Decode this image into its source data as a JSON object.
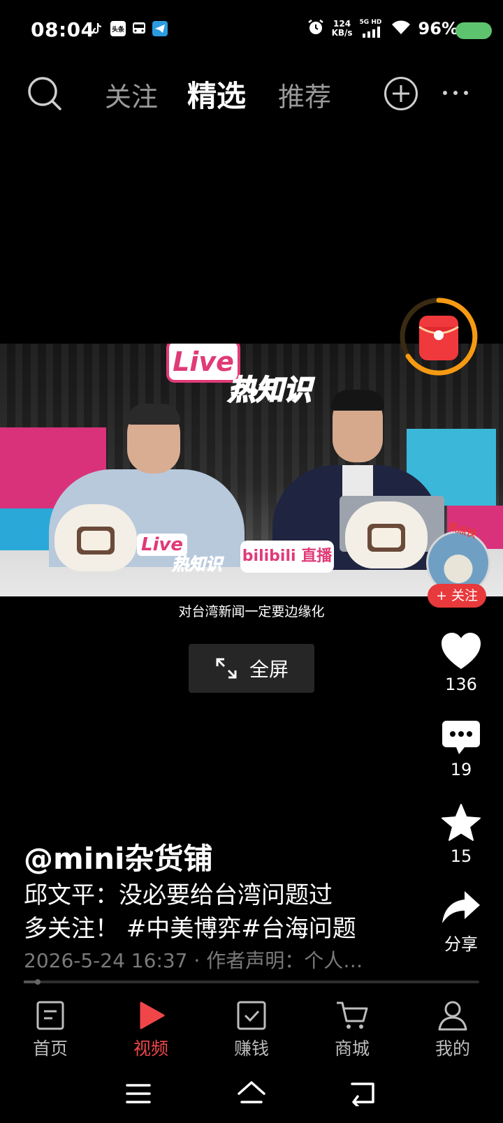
{
  "status_bar": {
    "time": "08:04",
    "app_icons": [
      "tiktok-icon",
      "toutiao-icon",
      "bus-icon",
      "telegram-icon"
    ],
    "net_speed_value": "124",
    "net_speed_unit": "KB/s",
    "network": "5G HD",
    "battery_percent": "96%",
    "battery_color": "#5ec36e"
  },
  "top_nav": {
    "tabs": [
      {
        "label": "关注",
        "active": false
      },
      {
        "label": "精选",
        "active": true
      },
      {
        "label": "推荐",
        "active": false
      }
    ]
  },
  "video": {
    "sign_live": "Live",
    "sign_rezhi": "热知识",
    "desk_live": "Live",
    "desk_rezhi": "热知识",
    "desk_bilibili": "bilibili 直播",
    "subtitle": "对台湾新闻一定要边缘化"
  },
  "fullscreen_label": "全屏",
  "creator": {
    "avatar_tag": "热点侠",
    "follow_label": "+ 关注"
  },
  "actions": {
    "likes": "136",
    "comments": "19",
    "favorites": "15",
    "share_label": "分享"
  },
  "post": {
    "author": "@mini杂货铺",
    "description_line1": "邱文平：没必要给台湾问题过",
    "description_line2": "多关注！ #中美博弈#台海问题",
    "meta": "2026-5-24 16:37 · 作者声明：个人…",
    "progress": 0.03
  },
  "bottom_nav": {
    "items": [
      {
        "label": "首页",
        "icon": "home-doc-icon",
        "active": false
      },
      {
        "label": "视频",
        "icon": "play-icon",
        "active": true
      },
      {
        "label": "赚钱",
        "icon": "checkbox-icon",
        "active": false
      },
      {
        "label": "商城",
        "icon": "cart-icon",
        "active": false
      },
      {
        "label": "我的",
        "icon": "person-icon",
        "active": false
      }
    ],
    "active_color": "#f0464a"
  }
}
